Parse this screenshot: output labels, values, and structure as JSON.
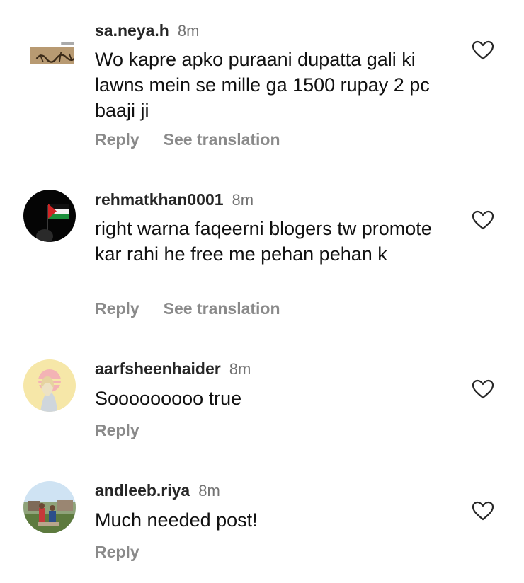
{
  "comments": [
    {
      "username": "sa.neya.h",
      "time": "8m",
      "text": "Wo kapre apko puraani dupatta gali ki lawns mein se mille ga 1500 rupay 2 pc baaji ji",
      "actions": [
        "Reply",
        "See translation"
      ],
      "avatar": "calligraphy-avatar"
    },
    {
      "username": "rehmatkhan0001",
      "time": "8m",
      "text": "right warna faqeerni blogers tw promote kar rahi he free me pehan pehan k",
      "actions": [
        "Reply",
        "See translation"
      ],
      "avatar": "palestine-flag-avatar"
    },
    {
      "username": "aarfsheenhaider",
      "time": "8m",
      "text": "Sooooooooo true",
      "actions": [
        "Reply"
      ],
      "avatar": "illustrated-girl-avatar"
    },
    {
      "username": "andleeb.riya",
      "time": "8m",
      "text": "Much needed post!",
      "actions": [
        "Reply"
      ],
      "avatar": "outdoor-photo-avatar"
    }
  ],
  "icons": {
    "like": "heart-outline-icon"
  },
  "colors": {
    "username": "#262626",
    "muted": "#737373",
    "action": "#8a8a8a"
  }
}
